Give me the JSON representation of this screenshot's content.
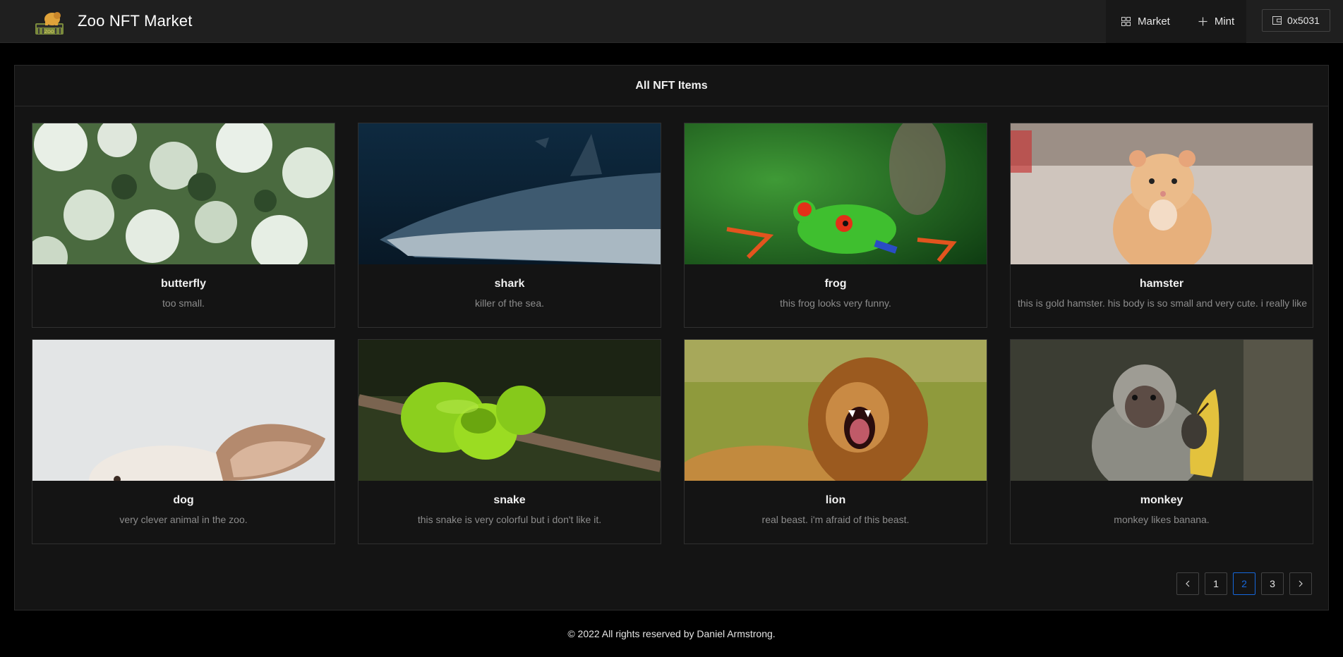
{
  "header": {
    "brand": "Zoo NFT Market",
    "logo_icon": "zoo-lion-logo-icon",
    "nav": [
      {
        "label": "Market",
        "icon": "grid-icon"
      },
      {
        "label": "Mint",
        "icon": "plus-icon"
      }
    ],
    "wallet": {
      "label": "0x5031",
      "icon": "wallet-icon"
    }
  },
  "panel": {
    "title": "All NFT Items"
  },
  "items": [
    {
      "name": "butterfly",
      "description": "too small."
    },
    {
      "name": "shark",
      "description": "killer of the sea."
    },
    {
      "name": "frog",
      "description": "this frog looks very funny."
    },
    {
      "name": "hamster",
      "description": "this is gold hamster. his body is so small and very cute. i really like"
    },
    {
      "name": "dog",
      "description": "very clever animal in the zoo."
    },
    {
      "name": "snake",
      "description": "this snake is very colorful but i don't like it."
    },
    {
      "name": "lion",
      "description": "real beast. i'm afraid of this beast."
    },
    {
      "name": "monkey",
      "description": "monkey likes banana."
    }
  ],
  "pagination": {
    "prev_icon": "chevron-left-icon",
    "pages": [
      "1",
      "2",
      "3"
    ],
    "current": "2",
    "next_icon": "chevron-right-icon"
  },
  "footer": {
    "text": "© 2022 All rights reserved by Daniel Armstrong."
  },
  "colors": {
    "header_bg": "#1f1f1f",
    "panel_bg": "#141414",
    "active_page": "#1668dc"
  }
}
